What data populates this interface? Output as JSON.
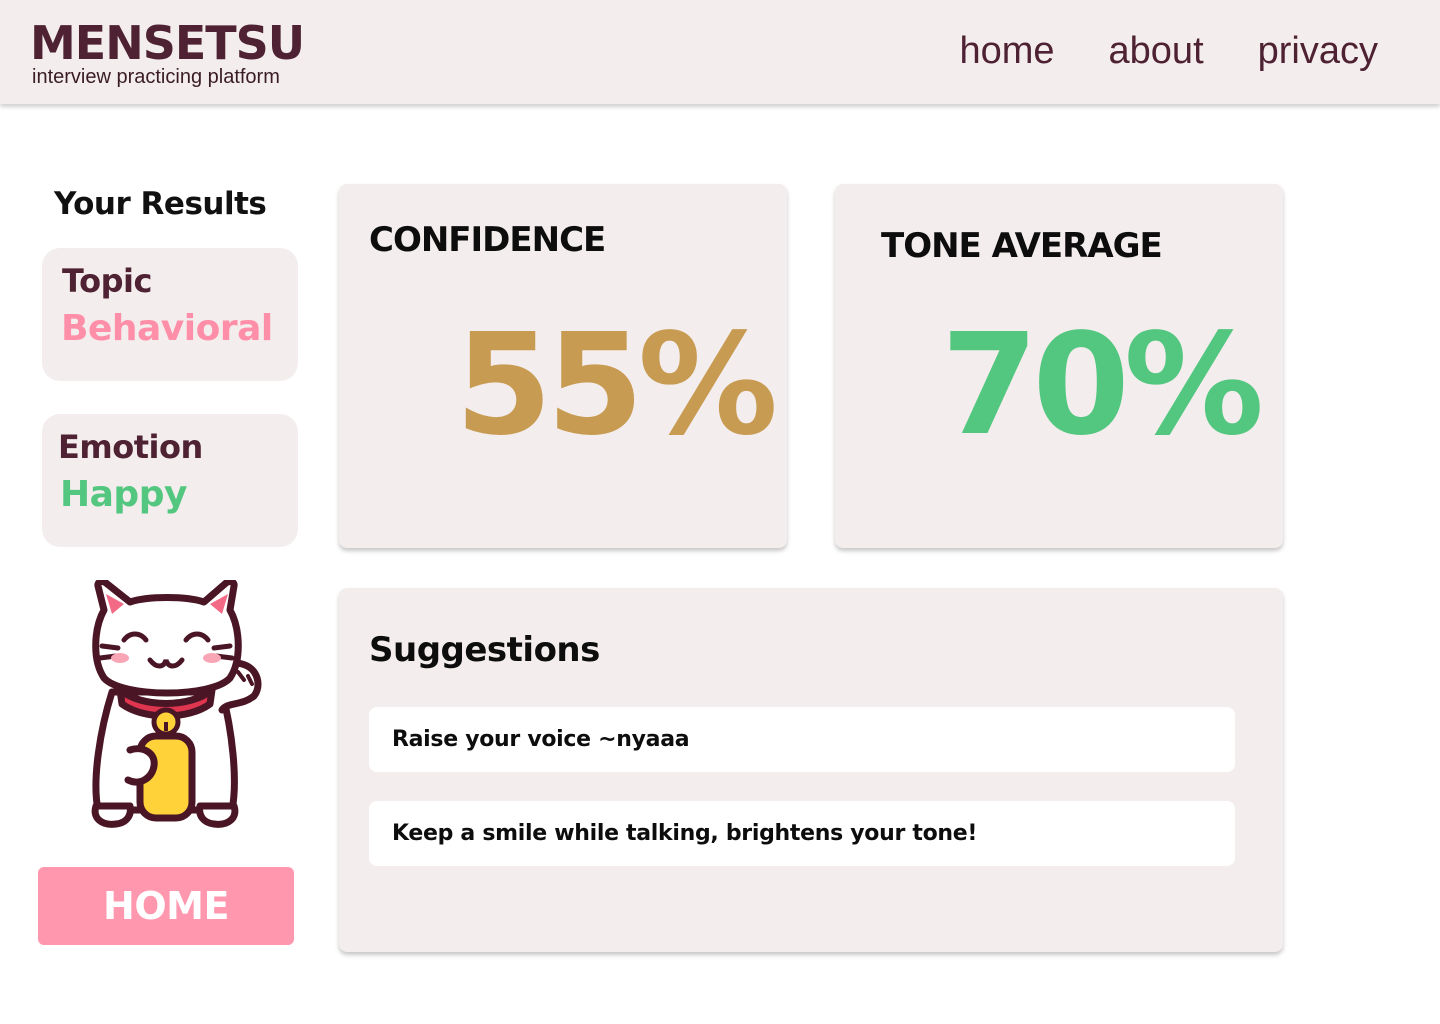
{
  "header": {
    "logo_title": "MENSETSU",
    "logo_subtitle": "interview practicing platform",
    "nav": [
      "home",
      "about",
      "privacy"
    ]
  },
  "sidebar": {
    "results_title": "Your Results",
    "topic": {
      "label": "Topic",
      "value": "Behavioral",
      "color": "#ff8fa8"
    },
    "emotion": {
      "label": "Emotion",
      "value": "Happy",
      "color": "#53c77f"
    },
    "mascot_icon": "lucky-cat-icon",
    "home_button": "HOME"
  },
  "metrics": {
    "confidence": {
      "label": "CONFIDENCE",
      "value": "55%",
      "color": "#c89b52"
    },
    "tone": {
      "label": "TONE AVERAGE",
      "value": "70%",
      "color": "#53c77f"
    }
  },
  "suggestions": {
    "title": "Suggestions",
    "items": [
      "Raise your voice ~nyaaa",
      "Keep a smile while talking, brightens your tone!"
    ]
  },
  "colors": {
    "brand": "#4e2232",
    "panel": "#f3eded",
    "accent_pink": "#ff97ae"
  }
}
